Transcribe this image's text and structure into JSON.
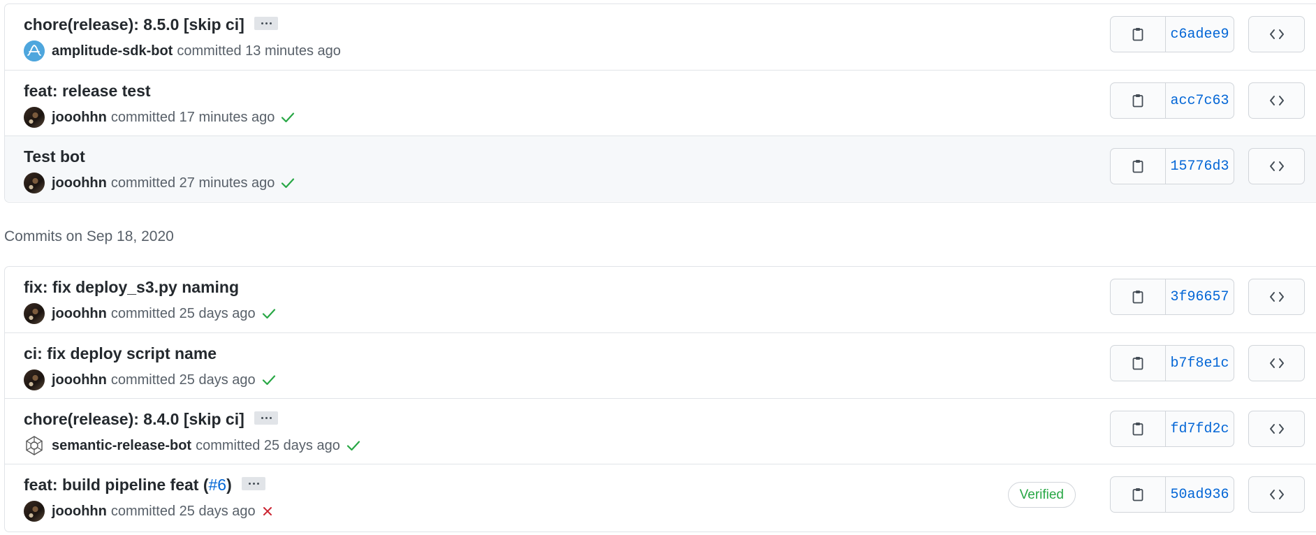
{
  "groups": [
    {
      "commits": [
        {
          "title": "chore(release): 8.5.0 [skip ci]",
          "has_ellipsis": true,
          "author": "amplitude-sdk-bot",
          "avatar": "amplitude-logo",
          "committed_text": "committed 13 minutes ago",
          "status": "none",
          "sha": "c6adee9"
        },
        {
          "title": "feat: release test",
          "has_ellipsis": false,
          "author": "jooohhn",
          "avatar": "user-photo",
          "committed_text": "committed 17 minutes ago",
          "status": "success",
          "sha": "acc7c63"
        },
        {
          "title": "Test bot",
          "has_ellipsis": false,
          "author": "jooohhn",
          "avatar": "user-photo",
          "committed_text": "committed 27 minutes ago",
          "status": "success",
          "sha": "15776d3"
        }
      ]
    },
    {
      "heading": "Commits on Sep 18, 2020",
      "commits": [
        {
          "title": "fix: fix deploy_s3.py naming",
          "has_ellipsis": false,
          "author": "jooohhn",
          "avatar": "user-photo",
          "committed_text": "committed 25 days ago",
          "status": "success",
          "sha": "3f96657"
        },
        {
          "title": "ci: fix deploy script name",
          "has_ellipsis": false,
          "author": "jooohhn",
          "avatar": "user-photo",
          "committed_text": "committed 25 days ago",
          "status": "success",
          "sha": "b7f8e1c"
        },
        {
          "title": "chore(release): 8.4.0 [skip ci]",
          "has_ellipsis": true,
          "author": "semantic-release-bot",
          "avatar": "semantic-release-logo",
          "committed_text": "committed 25 days ago",
          "status": "success",
          "sha": "fd7fd2c"
        },
        {
          "title_prefix": "feat: build pipeline feat (",
          "pr_link": "#6",
          "title_suffix": ")",
          "has_ellipsis": true,
          "author": "jooohhn",
          "avatar": "user-photo",
          "committed_text": "committed 25 days ago",
          "status": "failure",
          "badge": "Verified",
          "sha": "50ad936"
        }
      ]
    }
  ],
  "icons": {
    "copy": "clipboard-icon",
    "browse": "code-icon",
    "success": "check-icon",
    "failure": "x-icon",
    "ellipsis": "ellipsis-icon"
  },
  "colors": {
    "link": "#0366d6",
    "success": "#28a745",
    "failure": "#cb2431",
    "border": "#e1e4e8",
    "muted": "#586069"
  }
}
